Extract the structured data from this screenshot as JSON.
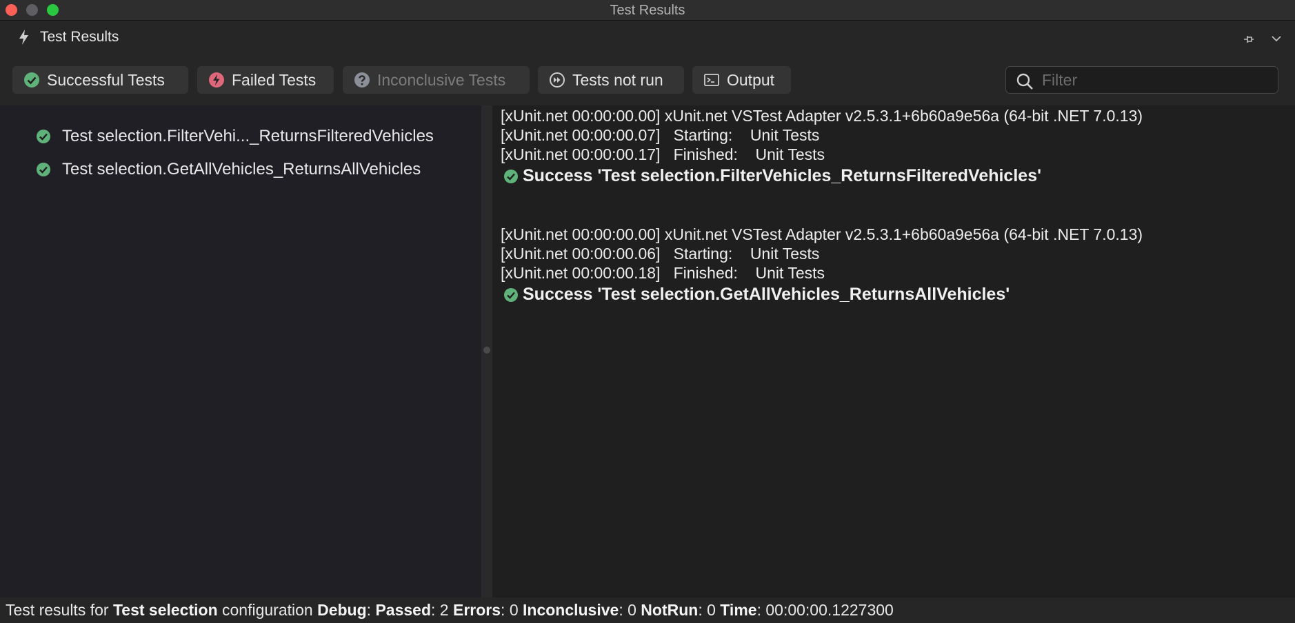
{
  "window": {
    "title": "Test Results"
  },
  "pad": {
    "title": "Test Results"
  },
  "toolbar": {
    "successful": "Successful Tests",
    "failed": "Failed Tests",
    "inconclusive": "Inconclusive Tests",
    "not_run": "Tests not run",
    "output": "Output",
    "filter_placeholder": "Filter",
    "filter_value": ""
  },
  "tree": [
    {
      "label": "Test selection.FilterVehi..._ReturnsFilteredVehicles",
      "status": "passed"
    },
    {
      "label": "Test selection.GetAllVehicles_ReturnsAllVehicles",
      "status": "passed"
    }
  ],
  "output": {
    "blocks": [
      {
        "lines": [
          "[xUnit.net 00:00:00.00] xUnit.net VSTest Adapter v2.5.3.1+6b60a9e56a (64-bit .NET 7.0.13)",
          "[xUnit.net 00:00:00.07]   Starting:    Unit Tests",
          "[xUnit.net 00:00:00.17]   Finished:    Unit Tests"
        ],
        "result": "Success 'Test selection.FilterVehicles_ReturnsFilteredVehicles'"
      },
      {
        "lines": [
          "[xUnit.net 00:00:00.00] xUnit.net VSTest Adapter v2.5.3.1+6b60a9e56a (64-bit .NET 7.0.13)",
          "[xUnit.net 00:00:00.06]   Starting:    Unit Tests",
          "[xUnit.net 00:00:00.18]   Finished:    Unit Tests"
        ],
        "result": "Success 'Test selection.GetAllVehicles_ReturnsAllVehicles'"
      }
    ]
  },
  "status": {
    "prefix": "Test results for ",
    "selection": "Test selection",
    "config_label": " configuration ",
    "config": "Debug",
    "passed_label": "Passed",
    "passed": "2",
    "errors_label": "Errors",
    "errors": "0",
    "inconclusive_label": "Inconclusive",
    "inconclusive": "0",
    "notrun_label": "NotRun",
    "notrun": "0",
    "time_label": "Time",
    "time": "00:00:00.1227300"
  },
  "colors": {
    "success": "#5fb27a",
    "failed": "#e0667a",
    "inconclusive": "#8a8f98",
    "close": "#fe5f57",
    "maximize": "#2ac840"
  }
}
